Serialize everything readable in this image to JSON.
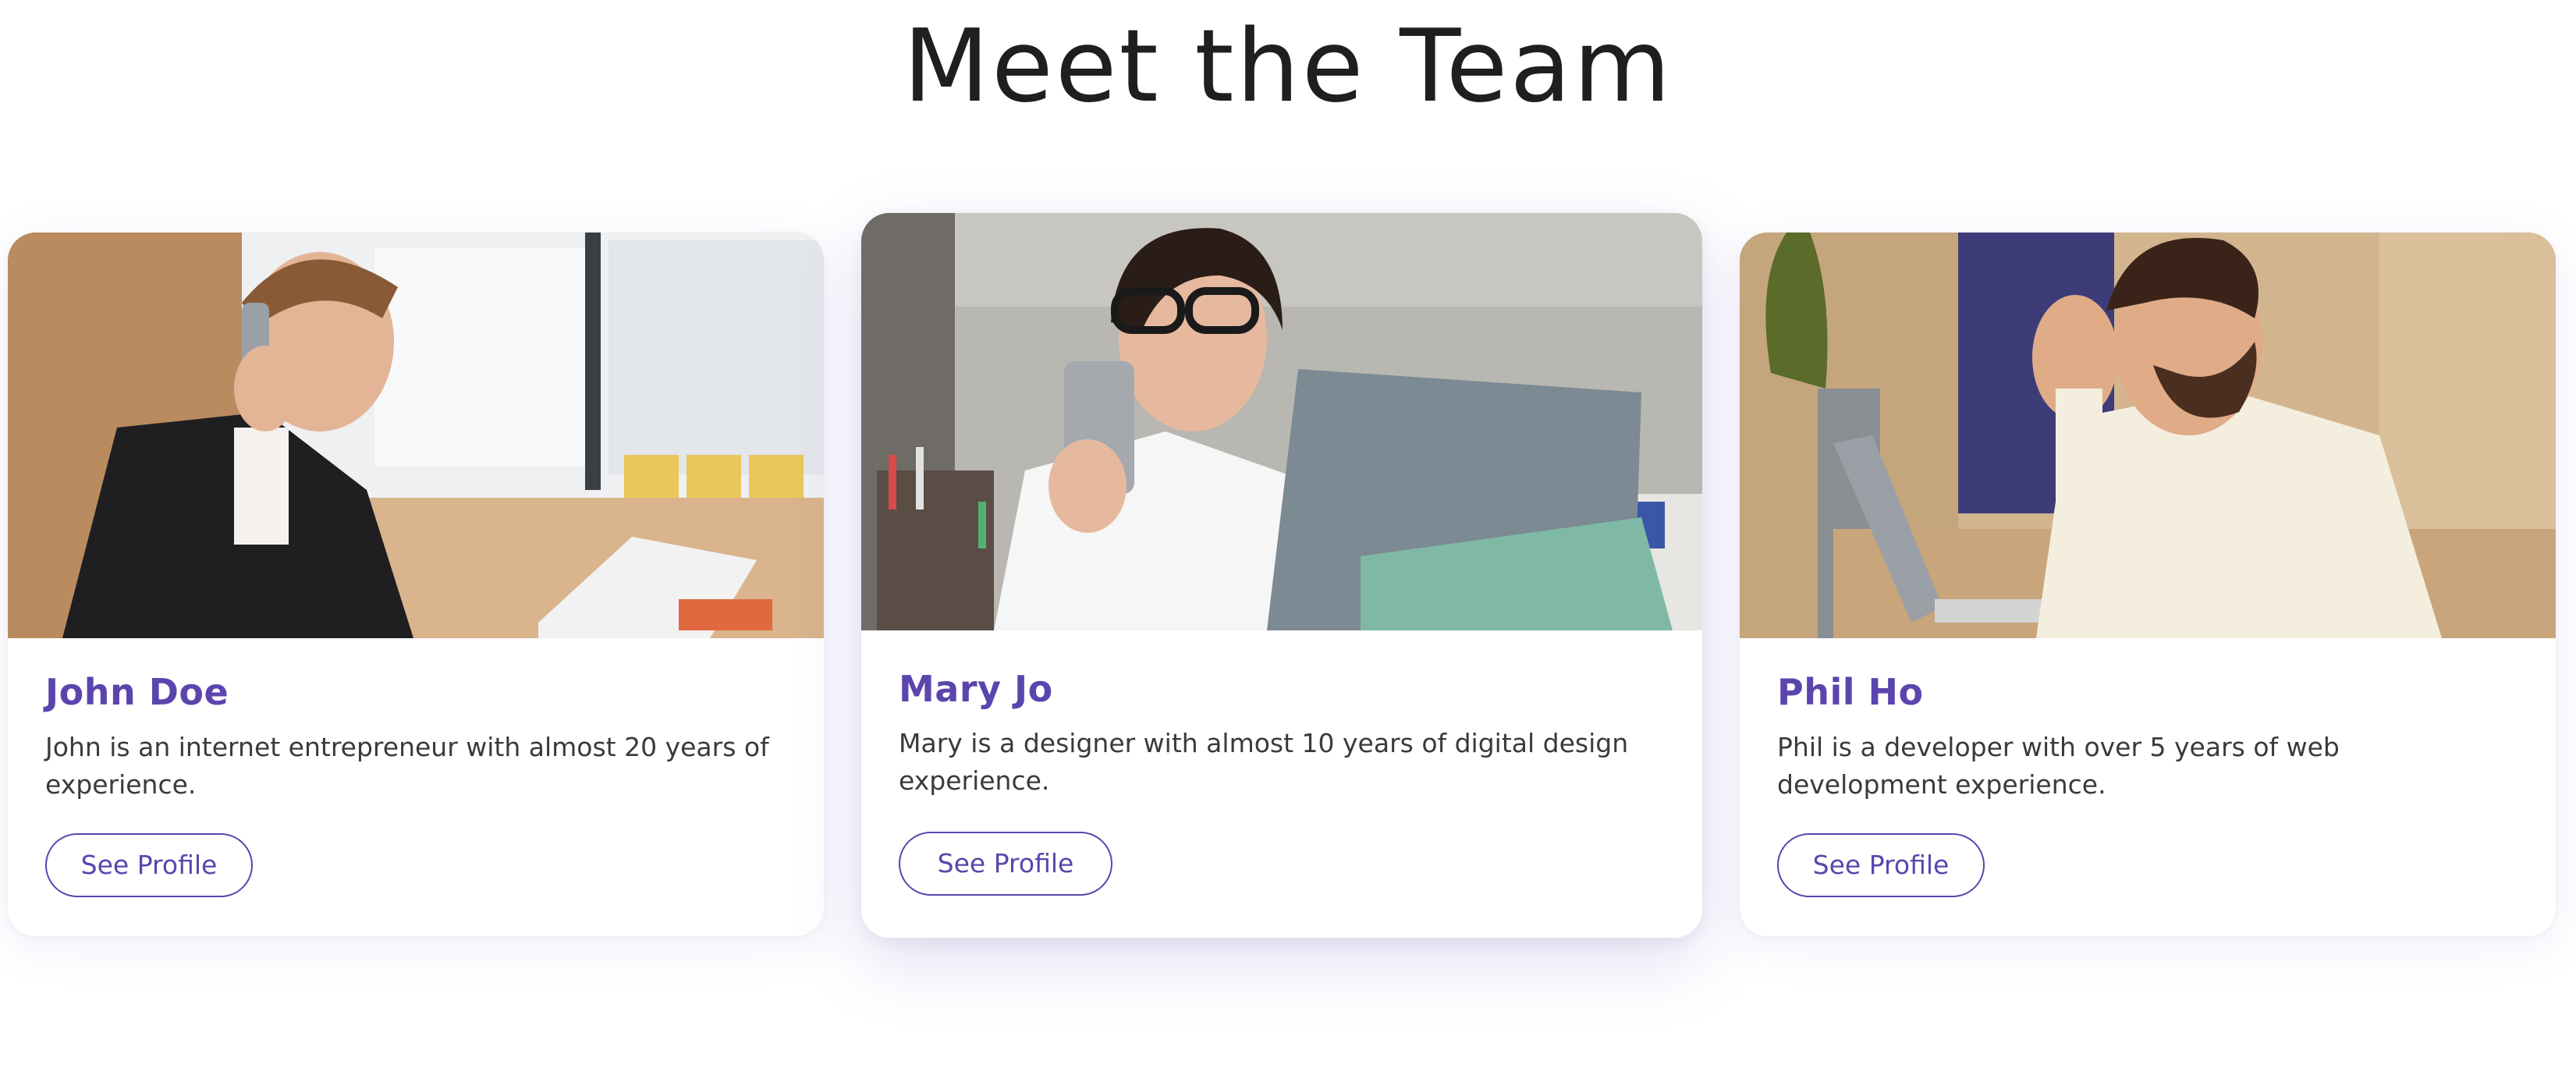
{
  "page": {
    "title": "Meet the Team",
    "accent_color": "#5b45ad",
    "text_color": "#3a3a3a"
  },
  "team": [
    {
      "name": "John Doe",
      "description": "John is an internet entrepreneur with almost 20 years of experience.",
      "button_label": "See Profile",
      "photo_alt": "Man in suit on the phone at a desk with laptop"
    },
    {
      "name": "Mary Jo",
      "description": "Mary is a designer with almost 10 years of digital design experience.",
      "button_label": "See Profile",
      "photo_alt": "Woman with glasses holding a phone behind a laptop"
    },
    {
      "name": "Phil Ho",
      "description": "Phil is a developer with over 5 years of web development experience.",
      "button_label": "See Profile",
      "photo_alt": "Bearded man looking down at a laptop"
    }
  ]
}
